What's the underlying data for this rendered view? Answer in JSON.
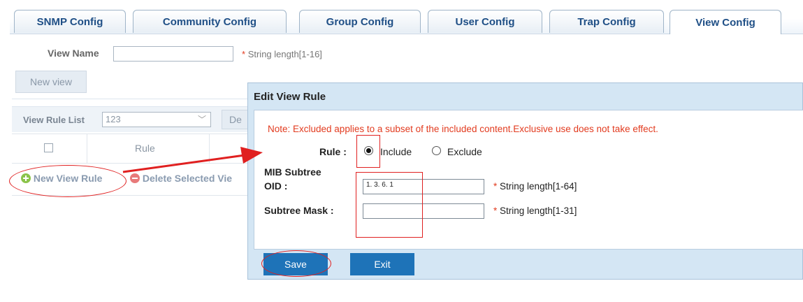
{
  "tabs": [
    {
      "label": "SNMP Config"
    },
    {
      "label": "Community Config"
    },
    {
      "label": "Group Config"
    },
    {
      "label": "User Config"
    },
    {
      "label": "Trap Config"
    },
    {
      "label": "View Config"
    }
  ],
  "view_form": {
    "view_name_label": "View Name",
    "view_name_value": "",
    "hint_star": "*",
    "hint": "String length[1-16]",
    "new_view_button": "New view"
  },
  "rule_list": {
    "label": "View Rule List",
    "selected_view": "123",
    "delete_button": "De",
    "column_rule": "Rule",
    "new_rule_link": "New View Rule",
    "delete_selected_link": "Delete Selected Vie"
  },
  "modal": {
    "title": "Edit View Rule",
    "note": "Note: Excluded applies to a subset of the included content.Exclusive use does not take effect.",
    "rule_label": "Rule :",
    "include_label": "Include",
    "exclude_label": "Exclude",
    "selected_rule": "Include",
    "mib_subtree_label": "MIB Subtree",
    "oid_label": "OID :",
    "oid_value": "1. 3. 6. 1",
    "oid_hint": "String length[1-64]",
    "mask_label": "Subtree Mask :",
    "mask_value": "",
    "mask_hint": "String length[1-31]",
    "required_star": "*",
    "save_button": "Save",
    "exit_button": "Exit"
  },
  "colors": {
    "accent": "#1e73b8",
    "tab_text": "#1f4f86",
    "note_red": "#e23b1f",
    "annotation_red": "#e02020"
  }
}
